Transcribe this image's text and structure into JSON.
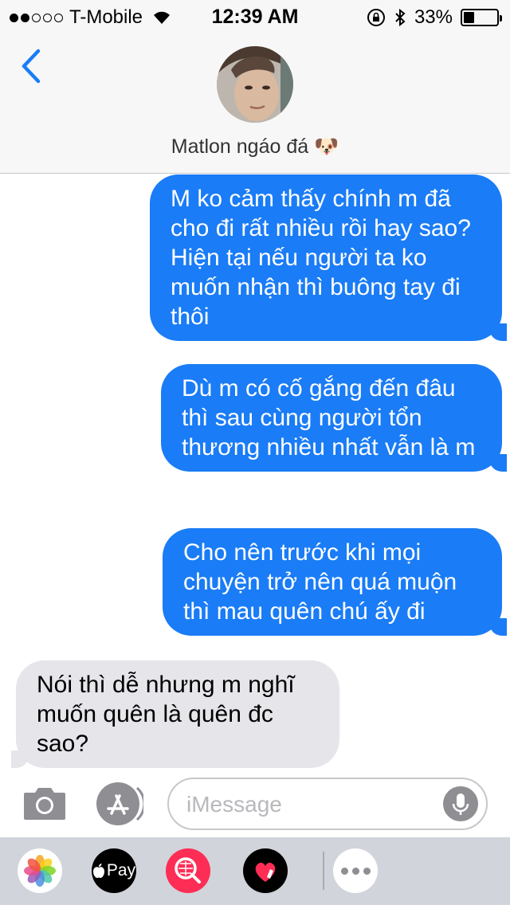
{
  "status_bar": {
    "carrier": "T-Mobile",
    "time": "12:39 AM",
    "battery": "33%",
    "battery_level": 0.33,
    "signal_bars": 2
  },
  "header": {
    "contact_name": "Matlon ngáo đá 🐶"
  },
  "messages": [
    {
      "direction": "out",
      "text": "M ko cảm thấy chính m đã cho đi rất nhiều rồi hay sao? Hiện tại nếu người ta ko muốn nhận thì buông tay đi thôi"
    },
    {
      "direction": "out",
      "text": "Dù m có cố gắng đến đâu thì sau cùng người tổn thương nhiều nhất vẫn là m"
    },
    {
      "direction": "out",
      "text": "Cho nên trước khi mọi chuyện trở nên quá muộn thì mau quên chú ấy đi"
    },
    {
      "direction": "in",
      "text": "Nói thì dễ nhưng m nghĩ muốn quên là quên đc sao?"
    }
  ],
  "input": {
    "placeholder": "iMessage"
  },
  "drawer": {
    "apple_pay_label": "Pay"
  },
  "colors": {
    "outgoing_bubble": "#1a7cf6",
    "incoming_bubble": "#e5e5ea",
    "accent": "#1a7cf6"
  }
}
